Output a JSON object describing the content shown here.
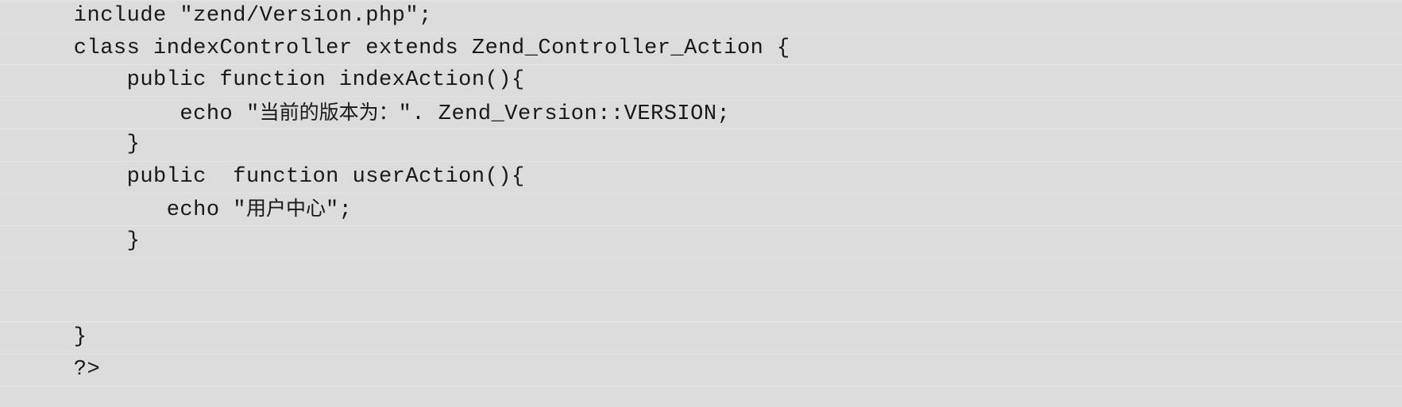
{
  "document": {
    "kind": "code-listing",
    "language": "php",
    "background_color": "#dcdcdc",
    "text_color": "#18181a",
    "rule_color": "#e6e6e6",
    "lines": [
      {
        "indent": "    ",
        "text": "include \"zend/Version.php\";"
      },
      {
        "indent": "    ",
        "text": "class indexController extends Zend_Controller_Action {"
      },
      {
        "indent": "        ",
        "text": "public function indexAction(){"
      },
      {
        "indent": "            ",
        "text": "echo \"当前的版本为：\". Zend_Version::VERSION;"
      },
      {
        "indent": "        ",
        "text": "}"
      },
      {
        "indent": "        ",
        "text": "public  function userAction(){"
      },
      {
        "indent": "           ",
        "text": "echo \"用户中心\";"
      },
      {
        "indent": "        ",
        "text": "}"
      },
      {
        "indent": "",
        "text": ""
      },
      {
        "indent": "",
        "text": ""
      },
      {
        "indent": "    ",
        "text": "}"
      },
      {
        "indent": "    ",
        "text": "?>"
      }
    ]
  }
}
